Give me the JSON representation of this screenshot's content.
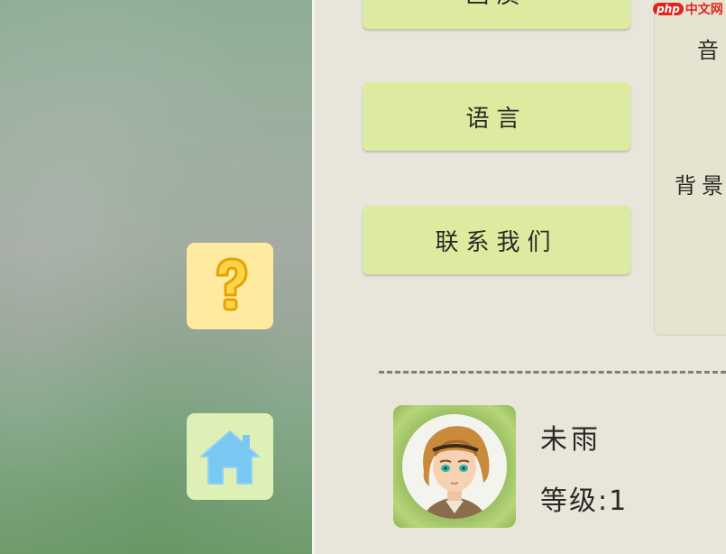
{
  "menu": {
    "top_button_label": "画质",
    "language_label": "语言",
    "contact_label": "联系我们"
  },
  "settings_panel": {
    "sound_label": "音",
    "bgm_label": "背景"
  },
  "side_buttons": {
    "help_icon": "question-mark-icon",
    "home_icon": "home-icon"
  },
  "player": {
    "name": "未雨",
    "level": "等级:1"
  },
  "watermark": {
    "logo": "php",
    "text": "中文网"
  },
  "colors": {
    "button_bg": "#ddeba0",
    "help_bg": "#ffeaa0",
    "home_bg": "#def0b6",
    "panel_bg": "#e8e6db"
  }
}
